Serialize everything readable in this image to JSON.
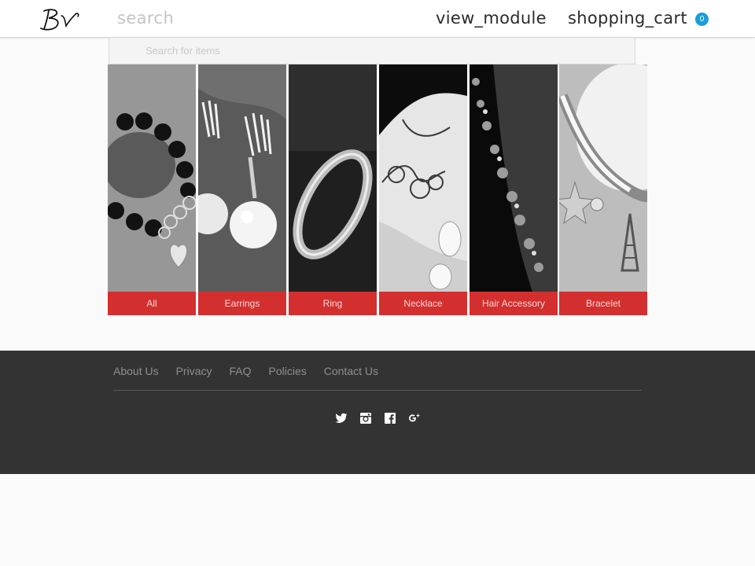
{
  "header": {
    "search_label": "search",
    "view_module_label": "view_module",
    "cart_label": "shopping_cart",
    "cart_count": "0",
    "badge_color": "#1a9ed9"
  },
  "search": {
    "placeholder": "Search for items"
  },
  "categories": [
    {
      "label": "All"
    },
    {
      "label": "Earrings"
    },
    {
      "label": "Ring"
    },
    {
      "label": "Necklace"
    },
    {
      "label": "Hair Accessory"
    },
    {
      "label": "Bracelet"
    }
  ],
  "footer": {
    "links": [
      "About Us",
      "Privacy",
      "FAQ",
      "Policies",
      "Contact Us"
    ],
    "social": [
      "twitter-icon",
      "instagram-icon",
      "facebook-icon",
      "google-plus-icon"
    ]
  },
  "colors": {
    "accent_red": "#d32f2f",
    "footer_bg": "#333333"
  }
}
